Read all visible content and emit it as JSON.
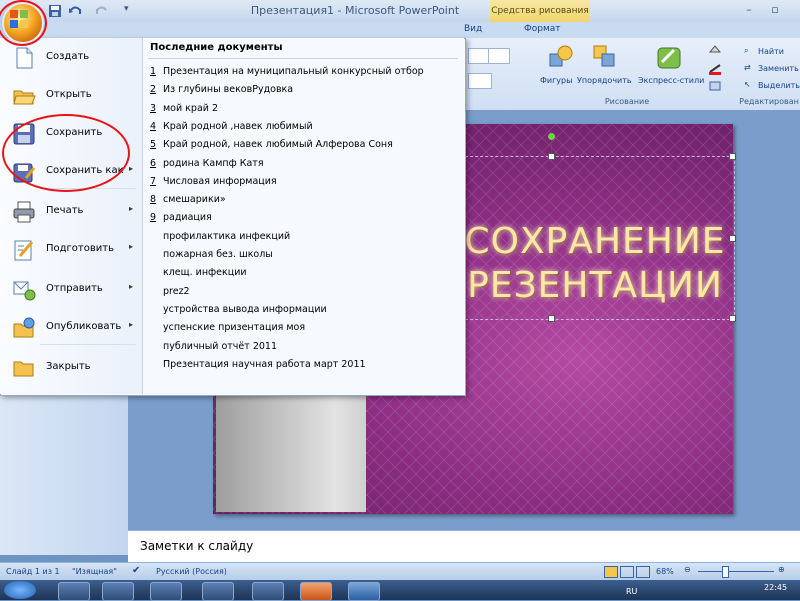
{
  "window": {
    "title": "Презентация1 - Microsoft PowerPoint",
    "contextual_tab_group": "Средства рисования",
    "min_label": "–",
    "max_label": "▫"
  },
  "tabs": {
    "view": "Вид",
    "format": "Формат"
  },
  "ribbon": {
    "shapes_label": "Фигуры",
    "arrange_label": "Упорядочить",
    "quick_styles_label": "Экспресс-стили",
    "drawing_group": "Рисование",
    "editing_group": "Редактирован",
    "find_label": "Найти",
    "replace_label": "Заменить",
    "select_label": "Выделить"
  },
  "office_menu": {
    "items": [
      {
        "label": "Создать",
        "icon": "new-document-icon"
      },
      {
        "label": "Открыть",
        "icon": "open-folder-icon"
      },
      {
        "label": "Сохранить",
        "icon": "save-disk-icon"
      },
      {
        "label": "Сохранить как",
        "icon": "save-as-icon"
      },
      {
        "label": "Печать",
        "icon": "printer-icon"
      },
      {
        "label": "Подготовить",
        "icon": "prepare-icon"
      },
      {
        "label": "Отправить",
        "icon": "send-icon"
      },
      {
        "label": "Опубликовать",
        "icon": "publish-icon"
      },
      {
        "label": "Закрыть",
        "icon": "close-folder-icon"
      }
    ],
    "recent_header": "Последние документы",
    "recent": [
      {
        "num": "1",
        "name": "Презентация на муниципальный конкурсный отбор"
      },
      {
        "num": "2",
        "name": "Из глубины вековРудовка"
      },
      {
        "num": "3",
        "name": "мой  край 2"
      },
      {
        "num": "4",
        "name": "Край родной ,навек любимый"
      },
      {
        "num": "5",
        "name": "Край родной, навек любимый Алферова Соня"
      },
      {
        "num": "6",
        "name": "родина Кампф Катя"
      },
      {
        "num": "7",
        "name": "Числовая информация"
      },
      {
        "num": "8",
        "name": "смешарики»"
      },
      {
        "num": "9",
        "name": "радиация"
      },
      {
        "num": "",
        "name": "профилактика инфекций"
      },
      {
        "num": "",
        "name": "пожарная без. школы"
      },
      {
        "num": "",
        "name": "клещ. инфекции"
      },
      {
        "num": "",
        "name": "prez2"
      },
      {
        "num": "",
        "name": "устройства вывода информации"
      },
      {
        "num": "",
        "name": "успенские  призентация моя"
      },
      {
        "num": "",
        "name": "публичный отчёт 2011"
      },
      {
        "num": "",
        "name": "Презентация научная работа март 2011"
      }
    ]
  },
  "slide": {
    "title_line1": "СОХРАНЕНИЕ",
    "title_line2": "РЕЗЕНТАЦИИ"
  },
  "notes": {
    "placeholder": "Заметки к слайду"
  },
  "status": {
    "slide_info": "Слайд 1 из 1",
    "theme": "\"Изящная\"",
    "language": "Русский (Россия)",
    "zoom": "68%"
  },
  "taskbar": {
    "lang": "RU",
    "time": "22:45"
  },
  "colors": {
    "annotation_red": "#e8141b",
    "slide_purple": "#8a2d82",
    "ribbon_blue": "#cfdff3"
  }
}
